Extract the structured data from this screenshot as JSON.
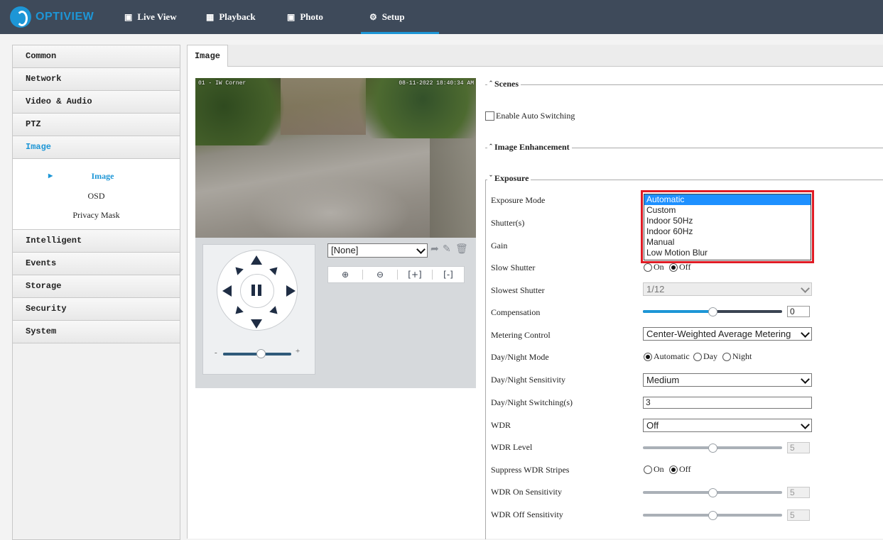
{
  "brand": {
    "name": "OPTIVIEW"
  },
  "topnav": [
    {
      "label": "Live View",
      "icon": "monitor-icon"
    },
    {
      "label": "Playback",
      "icon": "film-icon"
    },
    {
      "label": "Photo",
      "icon": "photo-icon"
    },
    {
      "label": "Setup",
      "icon": "gear-icon",
      "active": true
    }
  ],
  "sidebar": {
    "items": [
      "Common",
      "Network",
      "Video & Audio",
      "PTZ",
      "Image",
      "Intelligent",
      "Events",
      "Storage",
      "Security",
      "System"
    ],
    "active": "Image",
    "subitems": [
      "Image",
      "OSD",
      "Privacy Mask"
    ],
    "active_sub": "Image"
  },
  "tab": {
    "label": "Image"
  },
  "video": {
    "overlay_left": "01 - IW Corner",
    "overlay_right": "08-11-2022 18:40:34 AM"
  },
  "ptz": {
    "preset": "[None]",
    "zoom_minus": "-",
    "zoom_plus": "+",
    "zoom_level": 0.55
  },
  "sections": {
    "scenes": "Scenes",
    "enhancement": "Image Enhancement",
    "exposure": "Exposure"
  },
  "scenes": {
    "auto_switching_label": "Enable Auto Switching",
    "auto_switching": false
  },
  "exposure": {
    "labels": {
      "mode": "Exposure Mode",
      "shutter": "Shutter(s)",
      "gain": "Gain",
      "slow_shutter": "Slow Shutter",
      "slowest_shutter": "Slowest Shutter",
      "compensation": "Compensation",
      "metering": "Metering Control",
      "daynight_mode": "Day/Night Mode",
      "daynight_sensitivity": "Day/Night Sensitivity",
      "daynight_switching": "Day/Night Switching(s)",
      "wdr": "WDR",
      "wdr_level": "WDR Level",
      "suppress_wdr": "Suppress WDR Stripes",
      "wdr_on": "WDR On Sensitivity",
      "wdr_off": "WDR Off Sensitivity"
    },
    "mode_options": [
      "Automatic",
      "Custom",
      "Indoor 50Hz",
      "Indoor 60Hz",
      "Manual",
      "Low Motion Blur"
    ],
    "mode_selected": "Automatic",
    "slow_shutter": {
      "on": "On",
      "off": "Off",
      "value": "Off"
    },
    "slowest_shutter": "1/12",
    "compensation": {
      "value": "0",
      "fraction": 0.5
    },
    "metering": "Center-Weighted Average Metering",
    "daynight_mode": {
      "options": [
        "Automatic",
        "Day",
        "Night"
      ],
      "value": "Automatic"
    },
    "daynight_sensitivity": "Medium",
    "daynight_switching": "3",
    "wdr": "Off",
    "wdr_level": {
      "value": "5",
      "fraction": 0.5
    },
    "suppress_wdr": {
      "on": "On",
      "off": "Off",
      "value": "Off"
    },
    "wdr_on": {
      "value": "5",
      "fraction": 0.5
    },
    "wdr_off": {
      "value": "5",
      "fraction": 0.5
    }
  },
  "colors": {
    "accent": "#1d96d6",
    "topbar": "#3e4a5a",
    "highlight": "#e01b24",
    "selected_option": "#1e90ff"
  }
}
